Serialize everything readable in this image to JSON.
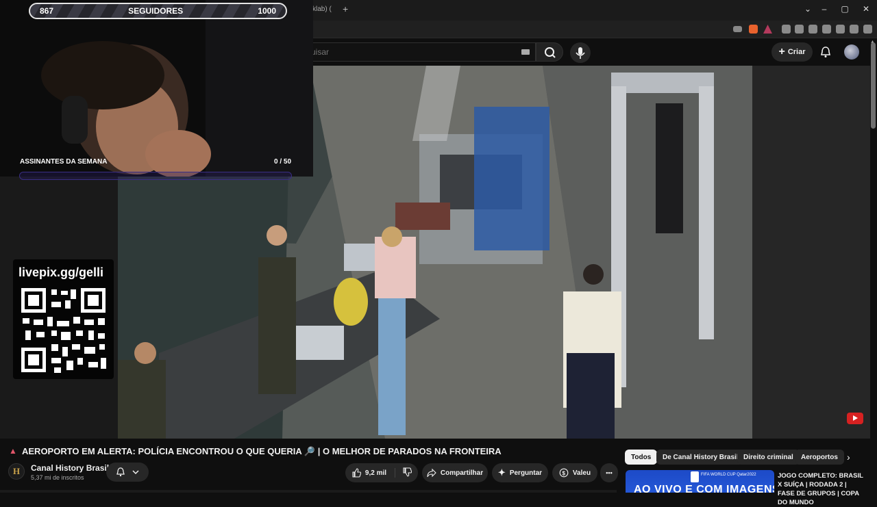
{
  "overlay": {
    "followers": {
      "current": "867",
      "label": "SEGUIDORES",
      "goal": "1000",
      "progress": 0.867
    },
    "subscribers": {
      "label": "ASSINANTES DA SEMANA",
      "count": "0 / 50",
      "progress": 0
    },
    "livepix": {
      "label": "livepix.gg/gelli"
    }
  },
  "browser": {
    "tab_fragment": "klab) (",
    "new_tab": "+",
    "window_controls": [
      "chevron-down-icon",
      "minimize-icon",
      "restore-icon",
      "close-icon"
    ]
  },
  "header": {
    "search_placeholder": "uisar",
    "create_label": "Criar"
  },
  "video": {
    "title": "AEROPORTO EM ALERTA: POLÍCIA ENCONTROU O QUE QUERIA 🔎 | O MELHOR DE PARADOS NA FRONTEIRA",
    "channel_name": "Canal History Brasil",
    "channel_avatar": "H",
    "subscribers": "5,37 mi de inscritos",
    "likes": "9,2 mil",
    "share_label": "Compartilhar",
    "ask_label": "Perguntar",
    "thanks_label": "Valeu",
    "more_label": "•••"
  },
  "chips": [
    "Todos",
    "De Canal History Brasil",
    "Direito criminal",
    "Aeroportos"
  ],
  "recommendation": {
    "thumb_text": "AO VIVO E COM IMAGENS",
    "thumb_badge": "FIFA WORLD CUP Qatar2022",
    "title": "JOGO COMPLETO: BRASIL X SUÍÇA | RODADA 2 | FASE DE GRUPOS | COPA DO MUNDO"
  },
  "colors": {
    "youtube_red": "#d62121",
    "accent_purple": "#3a2e86",
    "chip_active": "#f1f1f1"
  }
}
